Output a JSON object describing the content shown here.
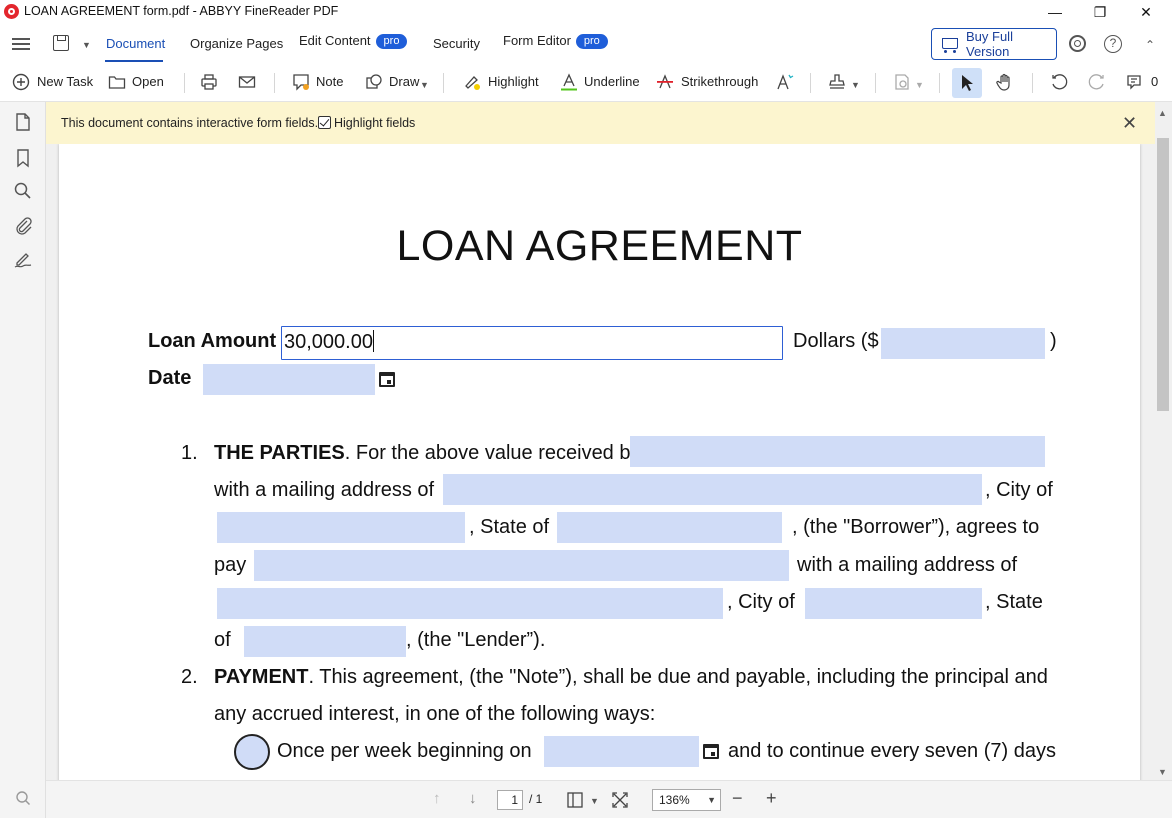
{
  "window": {
    "title": "LOAN AGREEMENT form.pdf - ABBYY FineReader PDF"
  },
  "tabs": [
    {
      "label": "Document"
    },
    {
      "label": "Organize Pages"
    },
    {
      "label": "Edit Content",
      "badge": "pro"
    },
    {
      "label": "Security"
    },
    {
      "label": "Form Editor",
      "badge": "pro"
    }
  ],
  "buy_button": "Buy Full Version",
  "toolbar": {
    "new_task": "New Task",
    "open": "Open",
    "note": "Note",
    "draw": "Draw",
    "highlight": "Highlight",
    "underline": "Underline",
    "strikethrough": "Strikethrough",
    "comment_count": "0"
  },
  "notice": {
    "text": "This document contains interactive form fields.",
    "highlight_fields": "Highlight fields",
    "highlight_checked": true
  },
  "document": {
    "title": "LOAN AGREEMENT",
    "loan_amount_label": "Loan Amount",
    "loan_amount_value": "30,000.00",
    "dollars_label": "Dollars ($",
    "close_paren": ")",
    "date_label": "Date",
    "item1_num": "1.",
    "item1_head": "THE PARTIES",
    "item1_line1": ". For the above value received by",
    "item1_line2": "with a mailing address of",
    "city_of": ", City of",
    "state_of": ", State of",
    "borrower": ", (the \"Borrower”), agrees to",
    "pay": "pay",
    "with_mailing": "with a mailing address of",
    "city_of2": ", City of",
    "state": ", State",
    "of": "of",
    "lender": ", (the \"Lender”).",
    "item2_num": "2.",
    "item2_head": "PAYMENT",
    "item2_line1": ". This agreement, (the \"Note”), shall be due and payable, including the principal and",
    "item2_line2": "any accrued interest, in one of the following ways:",
    "option1": "Once per week beginning on",
    "option1_tail": "and to continue every seven (7) days"
  },
  "status": {
    "page_current": "1",
    "page_total": "/ 1",
    "zoom": "136%"
  },
  "colors": {
    "accent": "#1a4fb5",
    "pro_badge": "#1f5ed9",
    "field_fill": "#d0dcf7",
    "notice_bg": "#fcf5cf"
  }
}
